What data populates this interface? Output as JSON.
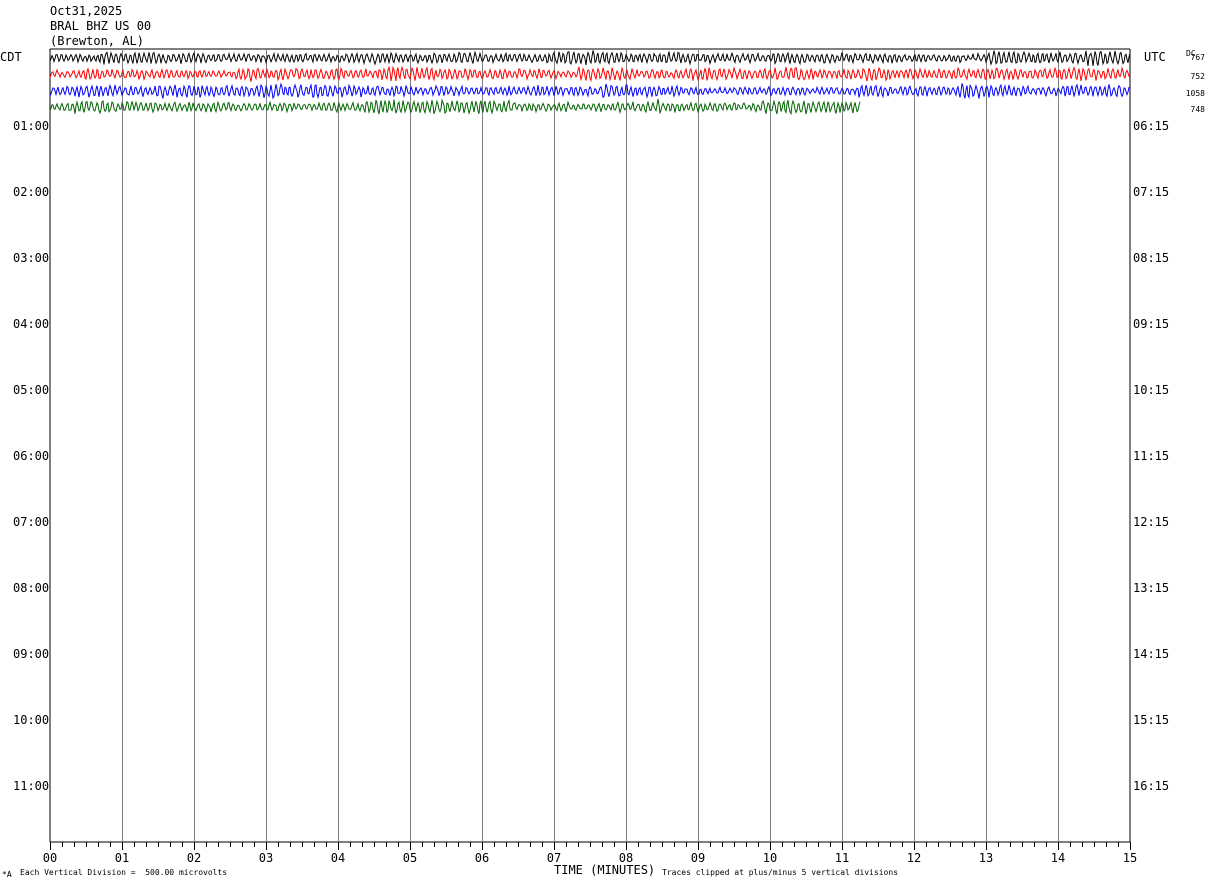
{
  "header": {
    "date": "Oct31,2025",
    "station": "BRAL BHZ US 00",
    "location": "(Brewton, AL)"
  },
  "left_tz": "CDT",
  "right_tz": "UTC",
  "dc_label": "DC",
  "footer": {
    "scale_note": "Each Vertical Division =  500.00 microvolts",
    "xlabel": "TIME (MINUTES)",
    "clip_note": "Traces clipped at plus/minus 5 vertical divisions",
    "corner_mark": "*A"
  },
  "chart_data": {
    "type": "line",
    "xlabel": "TIME (MINUTES)",
    "x_ticks": [
      "00",
      "01",
      "02",
      "03",
      "04",
      "05",
      "06",
      "07",
      "08",
      "09",
      "10",
      "11",
      "12",
      "13",
      "14",
      "15"
    ],
    "xlim": [
      0,
      15
    ],
    "left_row_labels": [
      "01:00",
      "02:00",
      "03:00",
      "04:00",
      "05:00",
      "06:00",
      "07:00",
      "08:00",
      "09:00",
      "10:00",
      "11:00"
    ],
    "right_row_labels": [
      "06:15",
      "07:15",
      "08:15",
      "09:15",
      "10:15",
      "11:15",
      "12:15",
      "13:15",
      "14:15",
      "15:15",
      "16:15"
    ],
    "grid": true,
    "traces": [
      {
        "row": 0,
        "color": "#000000",
        "dc_offset": "767",
        "end_minute": 15
      },
      {
        "row": 1,
        "color": "#ff0000",
        "dc_offset": "752",
        "end_minute": 15
      },
      {
        "row": 2,
        "color": "#0000ff",
        "dc_offset": "1058",
        "end_minute": 15
      },
      {
        "row": 3,
        "color": "#006400",
        "dc_offset": "748",
        "end_minute": 11.25
      }
    ]
  }
}
